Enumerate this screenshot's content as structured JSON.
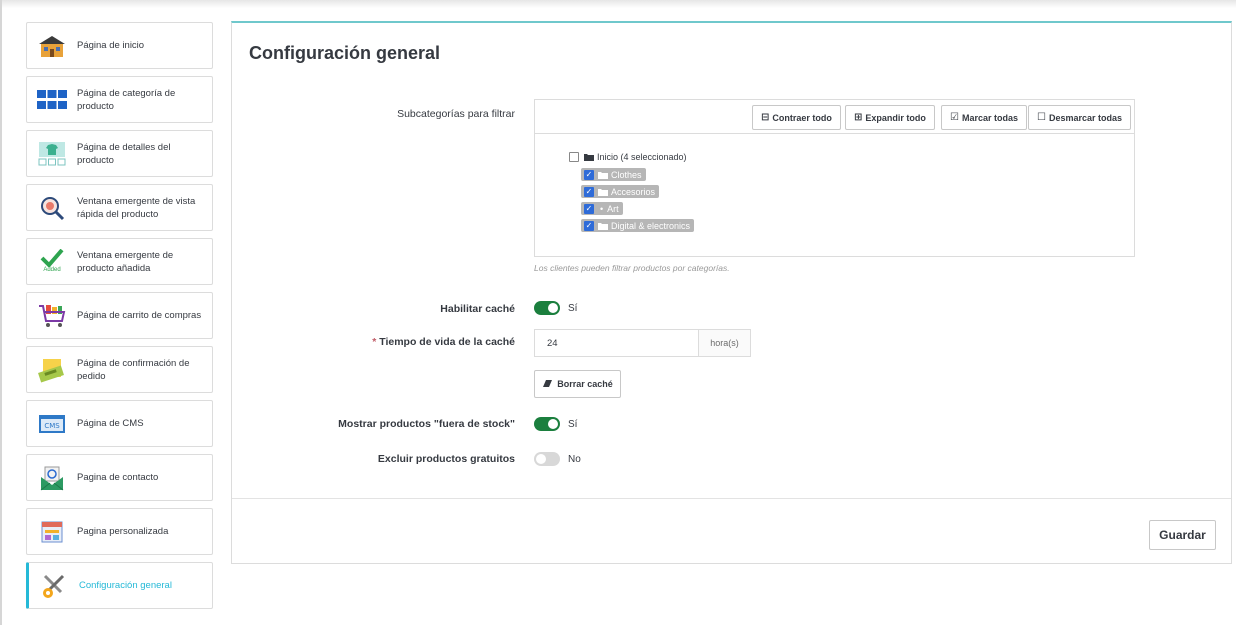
{
  "sidebar": {
    "items": [
      {
        "label": "Página de inicio",
        "icon": "house-icon"
      },
      {
        "label": "Página de categoría de producto",
        "icon": "grid-icon"
      },
      {
        "label": "Página de detalles del producto",
        "icon": "product-details-icon"
      },
      {
        "label": "Ventana emergente de vista rápida del producto",
        "icon": "magnifier-icon"
      },
      {
        "label": "Ventana emergente de producto añadida",
        "icon": "added-check-icon",
        "icon_text": "Added"
      },
      {
        "label": "Página de carrito de compras",
        "icon": "shopping-cart-icon"
      },
      {
        "label": "Página de confirmación de pedido",
        "icon": "order-confirmation-icon"
      },
      {
        "label": "Página de CMS",
        "icon": "cms-icon",
        "icon_text": "CMS"
      },
      {
        "label": "Pagina de contacto",
        "icon": "contact-envelope-icon"
      },
      {
        "label": "Pagina personalizada",
        "icon": "custom-page-icon"
      },
      {
        "label": "Configuración general",
        "icon": "tools-gear-icon",
        "active": true
      }
    ]
  },
  "main": {
    "title": "Configuración general",
    "subcategories": {
      "label": "Subcategorías para filtrar",
      "toolbar": {
        "collapse": "Contraer todo",
        "expand": "Expandir todo",
        "check_all": "Marcar todas",
        "uncheck_all": "Desmarcar todas"
      },
      "tree": {
        "root": "Inicio (4 seleccionado)",
        "children": [
          "Clothes",
          "Accesorios",
          "Art",
          "Digital & electronics"
        ]
      },
      "hint": "Los clientes pueden filtrar productos por categorías."
    },
    "enable_cache": {
      "label": "Habilitar caché",
      "state": "Sí"
    },
    "cache_lifetime": {
      "label": "Tiempo de vida de la caché",
      "required_mark": "*",
      "value": "24",
      "unit": "hora(s)"
    },
    "clear_cache": {
      "label": "Borrar caché"
    },
    "show_out_of_stock": {
      "label": "Mostrar productos \"fuera de stock\"",
      "state": "Sí"
    },
    "exclude_free": {
      "label": "Excluir productos gratuitos",
      "state": "No"
    },
    "save": "Guardar"
  },
  "colors": {
    "accent": "#25b9d7",
    "switch_on": "#1b7f3e",
    "checkbox": "#2e6bd8"
  }
}
